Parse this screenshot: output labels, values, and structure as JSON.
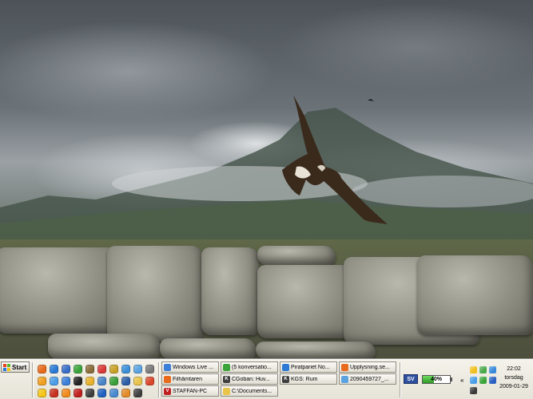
{
  "start": {
    "label": "Start"
  },
  "quick_launch": [
    {
      "icon": "firefox-icon",
      "color": "#e86a1c"
    },
    {
      "icon": "ie-icon",
      "color": "#2b7bd6"
    },
    {
      "icon": "outlook-icon",
      "color": "#3a6fc9"
    },
    {
      "icon": "xbox-icon",
      "color": "#3aa43a"
    },
    {
      "icon": "book-icon",
      "color": "#8a6d3b"
    },
    {
      "icon": "mail-icon",
      "color": "#d93a3a"
    },
    {
      "icon": "media-icon",
      "color": "#c9a227"
    },
    {
      "icon": "globe-icon",
      "color": "#3d8fd9"
    },
    {
      "icon": "picture-icon",
      "color": "#5aa3e0"
    },
    {
      "icon": "settings-icon",
      "color": "#7b7b7b"
    },
    {
      "icon": "orange-icon",
      "color": "#f0a020"
    },
    {
      "icon": "chat-icon",
      "color": "#4c9ee8"
    },
    {
      "icon": "messenger-icon",
      "color": "#3c7fd8"
    },
    {
      "icon": "black-icon",
      "color": "#222222"
    },
    {
      "icon": "pencil-icon",
      "color": "#e8b22c"
    },
    {
      "icon": "search-icon",
      "color": "#4a84c8"
    },
    {
      "icon": "green-icon",
      "color": "#39a039"
    },
    {
      "icon": "player-icon",
      "color": "#2c5fa8"
    },
    {
      "icon": "folder-icon",
      "color": "#e9c44a"
    },
    {
      "icon": "red-icon",
      "color": "#d9482c"
    },
    {
      "icon": "sun-icon",
      "color": "#f5c518"
    },
    {
      "icon": "pen-icon",
      "color": "#c83020"
    },
    {
      "icon": "vlc-icon",
      "color": "#f08a1c"
    },
    {
      "icon": "ve-icon",
      "color": "#c02020"
    },
    {
      "icon": "k-icon",
      "color": "#3f3f3f"
    },
    {
      "icon": "music-icon",
      "color": "#2060c0"
    },
    {
      "icon": "window-icon",
      "color": "#4a8ad0"
    },
    {
      "icon": "photo-icon",
      "color": "#e28b2a"
    },
    {
      "icon": "film-icon",
      "color": "#404040"
    }
  ],
  "tasks": [
    {
      "label": "Windows Live ...",
      "icon_color": "#3c7fd8",
      "icon_text": "",
      "active": false
    },
    {
      "label": "(5 konversatio...",
      "icon_color": "#3aa43a",
      "icon_text": "",
      "active": false
    },
    {
      "label": "Piratpariet No...",
      "icon_color": "#2b7bd6",
      "icon_text": "",
      "active": false
    },
    {
      "label": "Upplysning.se...",
      "icon_color": "#e86a1c",
      "icon_text": "",
      "active": false
    },
    {
      "label": "Filhämtaren",
      "icon_color": "#e86a1c",
      "icon_text": "",
      "active": false
    },
    {
      "label": "CGoban: Huv...",
      "icon_color": "#3f3f3f",
      "icon_text": "K",
      "active": false
    },
    {
      "label": "KGS: Rum",
      "icon_color": "#3f3f3f",
      "icon_text": "K",
      "active": false
    },
    {
      "label": "2090459727_...",
      "icon_color": "#5aa3e0",
      "icon_text": "",
      "active": false
    },
    {
      "label": "STAFFAN-PC",
      "icon_color": "#c02020",
      "icon_text": "V",
      "active": false
    },
    {
      "label": "C:\\Documents...",
      "icon_color": "#e9c44a",
      "icon_text": "",
      "active": false
    }
  ],
  "language": "SV",
  "battery": {
    "label": "40%",
    "percent": 40
  },
  "tray_icons": [
    {
      "icon": "network-icon",
      "color": "#f0c020"
    },
    {
      "icon": "people-icon",
      "color": "#4aa84a"
    },
    {
      "icon": "shield-icon",
      "color": "#3a8ad8"
    },
    {
      "icon": "update-icon",
      "color": "#4a9ee8"
    },
    {
      "icon": "refresh-icon",
      "color": "#3aa43a"
    },
    {
      "icon": "ve-tray-icon",
      "color": "#2a60c0"
    },
    {
      "icon": "volume-icon",
      "color": "#3a3a3a"
    }
  ],
  "clock": {
    "time": "22:02",
    "day": "torsdag",
    "date": "2009-01-29"
  }
}
